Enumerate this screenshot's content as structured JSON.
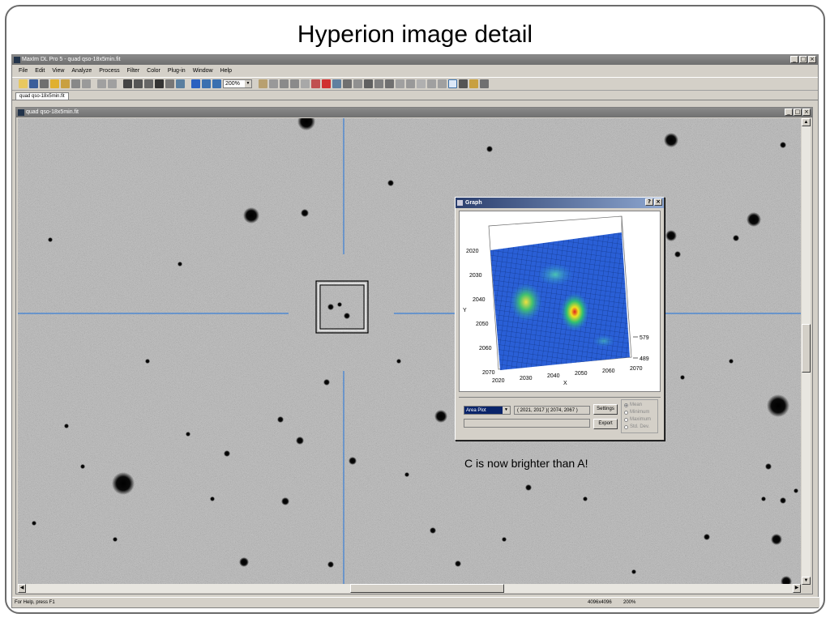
{
  "slide": {
    "title": "Hyperion image detail",
    "caption": "C is now brighter than A!"
  },
  "app": {
    "title": "MaxIm DL Pro 5 - quad qso-18x5min.fit",
    "window_buttons": [
      "_",
      "□",
      "×"
    ],
    "menu": [
      "File",
      "Edit",
      "View",
      "Analyze",
      "Process",
      "Filter",
      "Color",
      "Plug-in",
      "Window",
      "Help"
    ],
    "zoom": "200%",
    "doc_tab": "quad qso-18x5min.fit"
  },
  "child": {
    "title": "quad qso-18x5min.fit",
    "window_buttons": [
      "_",
      "□",
      "×"
    ]
  },
  "status": {
    "help": "For Help, press F1",
    "resolution": "4096x4096",
    "zoom": "200%"
  },
  "graph": {
    "title": "Graph",
    "title_buttons": [
      "?",
      "×"
    ],
    "plot_type": "Area Plot",
    "coords": "( 2021, 2017 )( 2074, 2067 )",
    "settings_label": "Settings",
    "export_label": "Export",
    "radio_options": [
      {
        "label": "Mean",
        "selected": true
      },
      {
        "label": "Minimum",
        "selected": false
      },
      {
        "label": "Maximum",
        "selected": false
      },
      {
        "label": "Std. Dev.",
        "selected": false
      }
    ],
    "y_label": "Y",
    "x_label": "X",
    "y_ticks": [
      "2020",
      "2030",
      "2040",
      "2050",
      "2060",
      "2070"
    ],
    "x_ticks": [
      "2020",
      "2030",
      "2040",
      "2050",
      "2060",
      "2070"
    ],
    "z_ticks": [
      "579",
      "489"
    ]
  },
  "colors": {
    "selection_box": "#000000",
    "crosshair": "#3a7fd5",
    "graph_title_start": "#2b3f6e"
  }
}
